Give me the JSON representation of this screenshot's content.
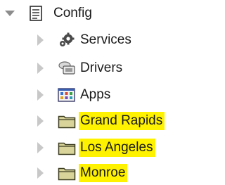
{
  "tree": {
    "root": {
      "label": "Config",
      "icon": "config-document-icon",
      "expanded": true
    },
    "children": [
      {
        "label": "Services",
        "icon": "gear-services-icon",
        "highlighted": false
      },
      {
        "label": "Drivers",
        "icon": "drivers-icon",
        "highlighted": false
      },
      {
        "label": "Apps",
        "icon": "apps-grid-icon",
        "highlighted": false
      },
      {
        "label": "Grand Rapids",
        "icon": "folder-icon",
        "highlighted": true
      },
      {
        "label": "Los Angeles",
        "icon": "folder-icon",
        "highlighted": true
      },
      {
        "label": "Monroe",
        "icon": "folder-icon",
        "highlighted": true
      }
    ]
  },
  "colors": {
    "highlight": "#fff200",
    "folder_fill": "#d8d49a",
    "folder_stroke": "#3b3b1f",
    "arrow_collapsed": "#c8c8c8",
    "arrow_expanded": "#8c8c8c"
  }
}
